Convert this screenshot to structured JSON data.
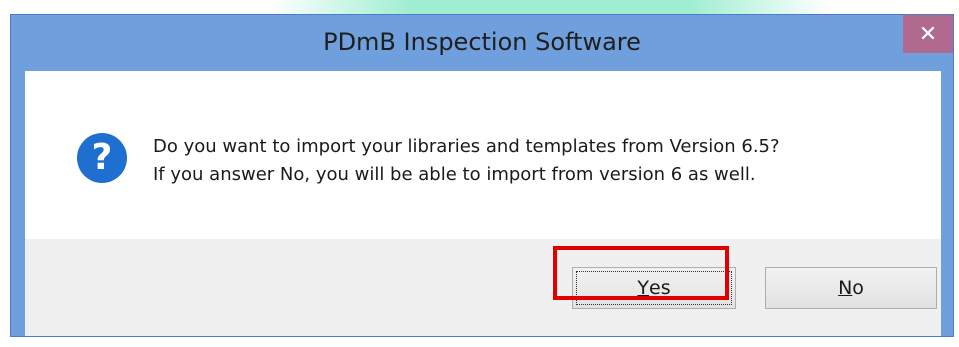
{
  "window": {
    "title": "PDmB Inspection Software",
    "close_glyph": "✕"
  },
  "message": {
    "icon": "question-icon",
    "icon_glyph": "?",
    "line1": "Do you want to import your libraries and templates from Version 6.5?",
    "line2": "If you answer No, you will be able to import from version 6 as well."
  },
  "buttons": {
    "yes": {
      "mnemonic": "Y",
      "rest": "es",
      "focused": true,
      "highlighted": true
    },
    "no": {
      "mnemonic": "N",
      "rest": "o",
      "focused": false,
      "highlighted": false
    }
  },
  "colors": {
    "titlebar": "#6f9fdc",
    "close_button": "#b06a8f",
    "icon": "#1e6fd0",
    "highlight": "#e00000",
    "footer": "#f0f0f0"
  }
}
